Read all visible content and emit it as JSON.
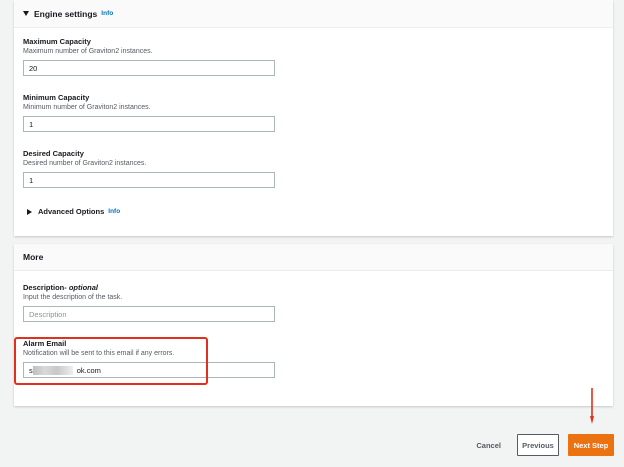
{
  "engine_settings": {
    "title": "Engine settings",
    "info": "Info",
    "max_capacity": {
      "label": "Maximum Capacity",
      "description": "Maximum number of Graviton2 instances.",
      "value": "20"
    },
    "min_capacity": {
      "label": "Minimum Capacity",
      "description": "Minimum number of Graviton2 instances.",
      "value": "1"
    },
    "desired_capacity": {
      "label": "Desired Capacity",
      "description": "Desired number of Graviton2 instances.",
      "value": "1"
    },
    "advanced": {
      "label": "Advanced Options",
      "info": "Info"
    }
  },
  "more": {
    "title": "More",
    "description_field": {
      "label": "Description",
      "label_optional": "- optional",
      "description": "Input the description of the task.",
      "placeholder": "Description"
    },
    "alarm_email": {
      "label": "Alarm Email",
      "description": "Notification will be sent to this email if any errors.",
      "value_prefix": "s",
      "value_suffix": "ok.com"
    }
  },
  "footer": {
    "cancel": "Cancel",
    "previous": "Previous",
    "next": "Next Step"
  },
  "colors": {
    "accent": "#ec7211",
    "link": "#0073bb",
    "annotation": "#e0301e"
  }
}
